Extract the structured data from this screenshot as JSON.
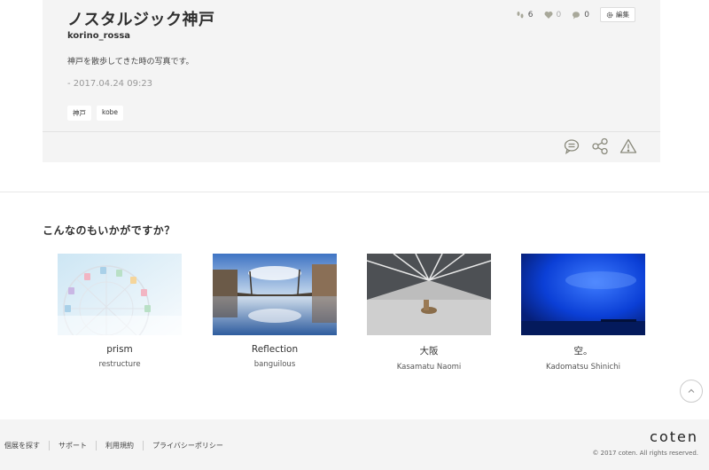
{
  "post": {
    "title": "ノスタルジック神戸",
    "username": "korino_rossa",
    "description": "神戸を散歩してきた時の写真です。",
    "date": "- 2017.04.24 09:23",
    "tags": [
      "神戸",
      "kobe"
    ],
    "stats": {
      "footprints": "6",
      "likes": "0",
      "comments": "0"
    },
    "edit_label": "編集",
    "actions": [
      "comment-icon",
      "share-icon",
      "warning-icon"
    ]
  },
  "recommend": {
    "heading": "こんなのもいかがですか？",
    "items": [
      {
        "title": "prism",
        "author": "restructure"
      },
      {
        "title": "Reflection",
        "author": "banguilous"
      },
      {
        "title": "大阪",
        "author": "Kasamatu Naomi"
      },
      {
        "title": "空。",
        "author": "Kadomatsu Shinichi"
      }
    ]
  },
  "footer": {
    "links": [
      "個展を探す",
      "サポート",
      "利用規約",
      "プライバシーポリシー"
    ],
    "brand": "coten",
    "copyright": "© 2017 coten. All rights reserved."
  },
  "colors": {
    "card_bg": "#f4f4f4",
    "accent_muted": "#a8a89a"
  }
}
